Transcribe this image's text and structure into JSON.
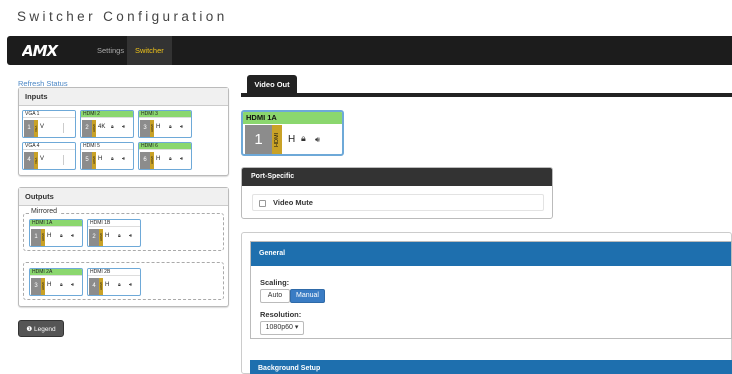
{
  "app": {
    "title": "Switcher Configuration"
  },
  "nav": {
    "logo": "AMX",
    "settings": "Settings",
    "switcher": "Switcher"
  },
  "refresh": "Refresh Status",
  "inputs": {
    "title": "Inputs",
    "cards": [
      {
        "label": "VGA 1",
        "num": "1",
        "tag": "VGA",
        "fmt": "V",
        "active": false
      },
      {
        "label": "HDMI 2",
        "num": "2",
        "tag": "HDMI",
        "fmt": "4K",
        "active": true
      },
      {
        "label": "HDMI 3",
        "num": "3",
        "tag": "HDMI",
        "fmt": "H",
        "active": true
      },
      {
        "label": "VGA 4",
        "num": "4",
        "tag": "VGA",
        "fmt": "V",
        "active": false
      },
      {
        "label": "HDMI 5",
        "num": "5",
        "tag": "HDMI",
        "fmt": "H",
        "active": false
      },
      {
        "label": "HDMI 6",
        "num": "6",
        "tag": "HDMI",
        "fmt": "H",
        "active": true
      }
    ]
  },
  "outputs": {
    "title": "Outputs",
    "group1_label": "Mirrored",
    "cards": [
      {
        "label": "HDMI 1A",
        "num": "1",
        "tag": "HDMI",
        "fmt": "H",
        "active": true
      },
      {
        "label": "HDMI 1B",
        "num": "2",
        "tag": "HDMI",
        "fmt": "H",
        "active": false
      },
      {
        "label": "HDMI 2A",
        "num": "3",
        "tag": "HDMI",
        "fmt": "H",
        "active": true
      },
      {
        "label": "HDMI 2B",
        "num": "4",
        "tag": "HDMI",
        "fmt": "H",
        "active": false
      }
    ]
  },
  "legend_button": "Legend",
  "tab": "Video Out",
  "selected": {
    "label": "HDMI 1A",
    "num": "1",
    "tag": "HDMI",
    "fmt": "H"
  },
  "port": {
    "title": "Port-Specific",
    "video_mute": "Video Mute"
  },
  "general": {
    "title": "General",
    "scaling_label": "Scaling:",
    "scaling_options": [
      "Auto",
      "Manual"
    ],
    "scaling_selected": "Manual",
    "resolution_label": "Resolution:",
    "resolution_value": "1080p60 ▾"
  },
  "background": {
    "title": "Background Setup"
  },
  "icons": {
    "lock": "lock-icon",
    "speaker": "speaker-icon",
    "info": "info-circle-icon"
  }
}
